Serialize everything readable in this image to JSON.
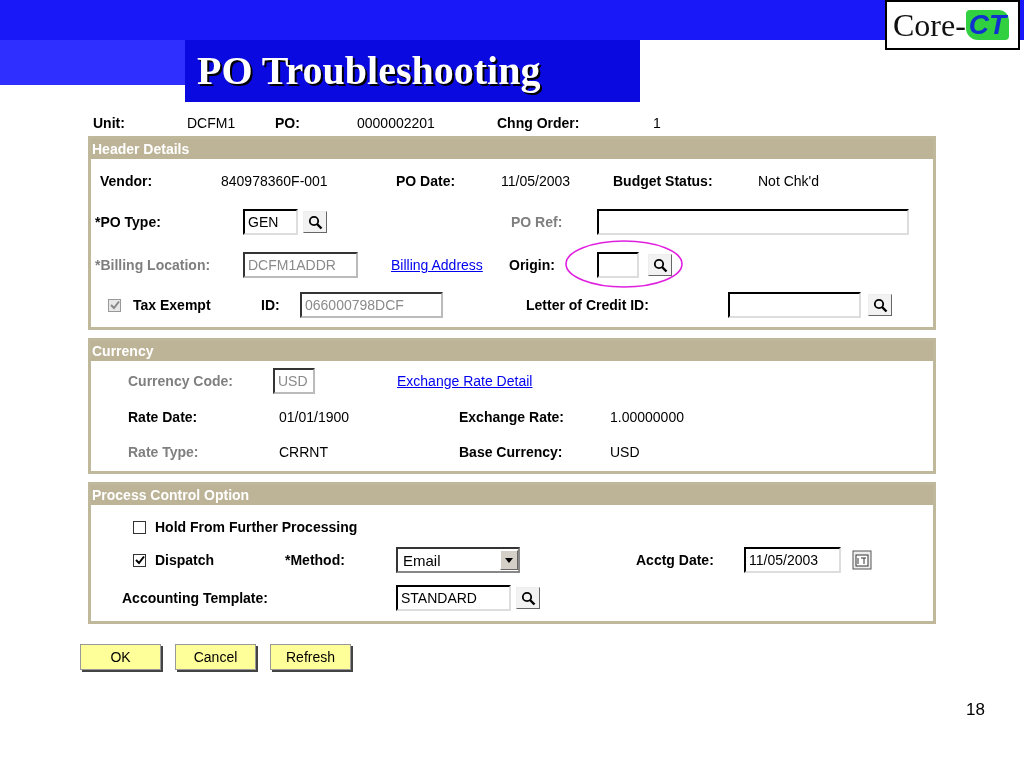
{
  "slide": {
    "title": "PO Troubleshooting",
    "page_number": "18",
    "logo": {
      "prefix": "Core-",
      "mark": "CT"
    }
  },
  "summary": [
    {
      "kind": "label",
      "text": "Unit:",
      "disabled": false
    },
    {
      "kind": "value",
      "text": "DCFM1"
    },
    {
      "kind": "label",
      "text": "PO:",
      "disabled": false
    },
    {
      "kind": "value",
      "text": "0000002201"
    },
    {
      "kind": "label",
      "text": "Chng Order:",
      "disabled": false
    },
    {
      "kind": "value",
      "text": "1"
    }
  ],
  "sections": [
    {
      "title": "Header Details",
      "rows": [
        {
          "items": [
            {
              "kind": "label",
              "text": "Vendor:",
              "disabled": false
            },
            {
              "kind": "value",
              "text": "840978360F-001"
            },
            {
              "kind": "label",
              "text": "PO Date:",
              "disabled": false
            },
            {
              "kind": "value",
              "text": "11/05/2003"
            },
            {
              "kind": "label",
              "text": "Budget Status:",
              "disabled": false
            },
            {
              "kind": "value",
              "text": "Not Chk'd"
            }
          ]
        },
        {
          "items": [
            {
              "kind": "label",
              "text": "*PO Type:",
              "disabled": false
            },
            {
              "kind": "input",
              "value": "GEN",
              "disabled": false
            },
            {
              "kind": "lookup"
            },
            {
              "kind": "label",
              "text": "PO Ref:",
              "disabled": true
            },
            {
              "kind": "input",
              "disabled": false
            }
          ]
        },
        {
          "items": [
            {
              "kind": "label",
              "text": "*Billing Location:",
              "disabled": true
            },
            {
              "kind": "input",
              "value": "DCFM1ADDR",
              "disabled": true
            },
            {
              "kind": "link",
              "text": "Billing Address"
            },
            {
              "kind": "label",
              "text": "Origin:",
              "disabled": false
            },
            {
              "kind": "input",
              "disabled": false,
              "circled": true
            },
            {
              "kind": "lookup"
            }
          ]
        },
        {
          "items": [
            {
              "kind": "checkbox",
              "checked": true,
              "disabled": true
            },
            {
              "kind": "label",
              "text": "Tax Exempt",
              "disabled": false
            },
            {
              "kind": "label",
              "text": "ID:",
              "disabled": false
            },
            {
              "kind": "input",
              "value": "066000798DCF",
              "disabled": true
            },
            {
              "kind": "label",
              "text": "Letter of Credit ID:",
              "disabled": false
            },
            {
              "kind": "input",
              "disabled": false
            },
            {
              "kind": "lookup"
            }
          ]
        }
      ]
    },
    {
      "title": "Currency",
      "rows": [
        {
          "items": [
            {
              "kind": "label",
              "text": "Currency Code:",
              "disabled": true
            },
            {
              "kind": "input",
              "value": "USD",
              "disabled": true
            },
            {
              "kind": "link",
              "text": "Exchange Rate Detail"
            }
          ]
        },
        {
          "items": [
            {
              "kind": "label",
              "text": "Rate Date:",
              "disabled": false
            },
            {
              "kind": "value",
              "text": "01/01/1900"
            },
            {
              "kind": "label",
              "text": "Exchange Rate:",
              "disabled": false
            },
            {
              "kind": "value",
              "text": "1.00000000"
            }
          ]
        },
        {
          "items": [
            {
              "kind": "label",
              "text": "Rate Type:",
              "disabled": true
            },
            {
              "kind": "value",
              "text": "CRRNT"
            },
            {
              "kind": "label",
              "text": "Base Currency:",
              "disabled": false
            },
            {
              "kind": "value",
              "text": "USD"
            }
          ]
        }
      ]
    },
    {
      "title": "Process Control Option",
      "rows": [
        {
          "items": [
            {
              "kind": "checkbox",
              "checked": false,
              "disabled": false
            },
            {
              "kind": "label",
              "text": "Hold From Further Processing",
              "disabled": false
            }
          ]
        },
        {
          "items": [
            {
              "kind": "checkbox",
              "checked": true,
              "disabled": false
            },
            {
              "kind": "label",
              "text": "Dispatch",
              "disabled": false
            },
            {
              "kind": "label",
              "text": "*Method:",
              "disabled": false
            },
            {
              "kind": "select",
              "value": "Email"
            },
            {
              "kind": "label",
              "text": "Acctg Date:",
              "disabled": false
            },
            {
              "kind": "input",
              "value": "11/05/2003",
              "disabled": false
            },
            {
              "kind": "calendar"
            }
          ]
        },
        {
          "items": [
            {
              "kind": "label",
              "text": "Accounting Template:",
              "disabled": false
            },
            {
              "kind": "input",
              "value": "STANDARD",
              "disabled": false
            },
            {
              "kind": "lookup"
            }
          ]
        }
      ]
    }
  ],
  "buttons": [
    {
      "label": "OK"
    },
    {
      "label": "Cancel"
    },
    {
      "label": "Refresh"
    }
  ]
}
